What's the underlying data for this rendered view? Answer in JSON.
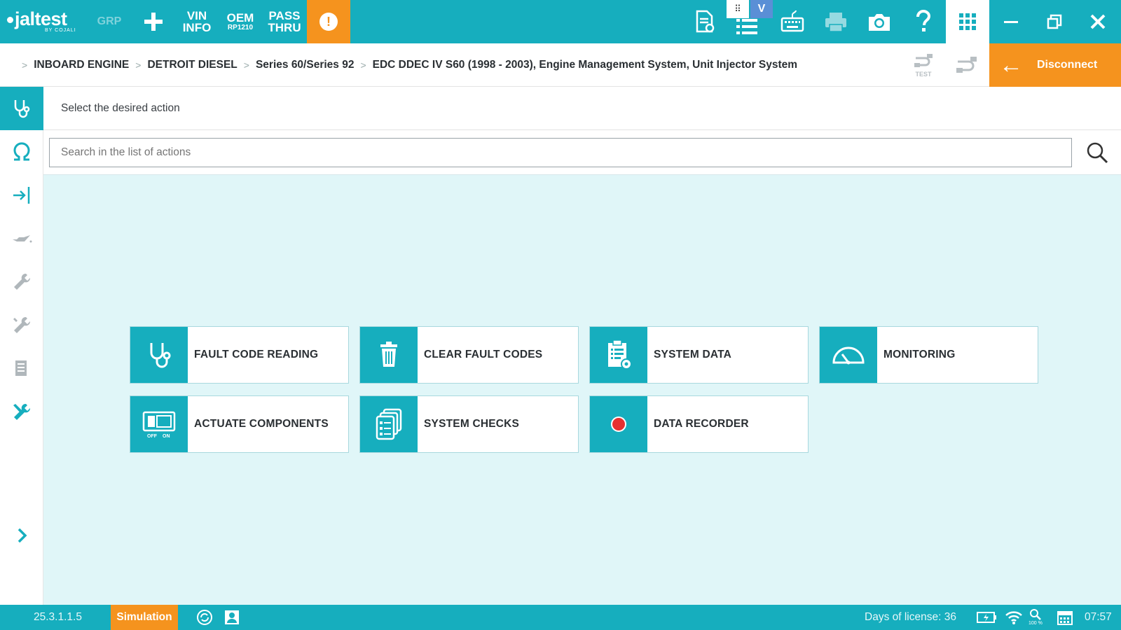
{
  "header": {
    "logo": "jaltest",
    "logo_sub": "BY COJALI",
    "grp": "GRP",
    "vin": {
      "line1": "VIN",
      "line2": "INFO"
    },
    "oem": {
      "line1": "OEM",
      "line2": "RP1210"
    },
    "pass": {
      "line1": "PASS",
      "line2": "THRU"
    },
    "warn": "!",
    "grid_mini": "⠿",
    "mini_check": "V"
  },
  "breadcrumb": [
    "INBOARD ENGINE",
    "DETROIT DIESEL",
    "Series 60/Series 92",
    "EDC DDEC IV S60 (1998 - 2003), Engine Management System, Unit Injector System"
  ],
  "breadcrumb_icons": {
    "test_label": "TEST"
  },
  "disconnect": {
    "label": "Disconnect"
  },
  "main": {
    "instruction": "Select the desired action",
    "search_placeholder": "Search in the list of actions"
  },
  "actions": [
    {
      "label": "FAULT CODE READING",
      "icon": "stethoscope-icon"
    },
    {
      "label": "CLEAR FAULT CODES",
      "icon": "trash-icon"
    },
    {
      "label": "SYSTEM DATA",
      "icon": "clipboard-gear-icon"
    },
    {
      "label": "MONITORING",
      "icon": "gauge-icon"
    },
    {
      "label": "ACTUATE COMPONENTS",
      "icon": "switch-panel-icon"
    },
    {
      "label": "SYSTEM CHECKS",
      "icon": "checklist-stack-icon"
    },
    {
      "label": "DATA RECORDER",
      "icon": "record-dot-icon"
    }
  ],
  "actuate_icon_text": {
    "off": "OFF",
    "on": "ON"
  },
  "status": {
    "version": "25.3.1.1.5",
    "mode": "Simulation",
    "license": "Days of license: 36",
    "zoom": "100 %",
    "time": "07:57"
  },
  "colors": {
    "teal": "#16aebe",
    "orange": "#f5931e",
    "background": "#e0f6f8",
    "record": "#e53030"
  }
}
